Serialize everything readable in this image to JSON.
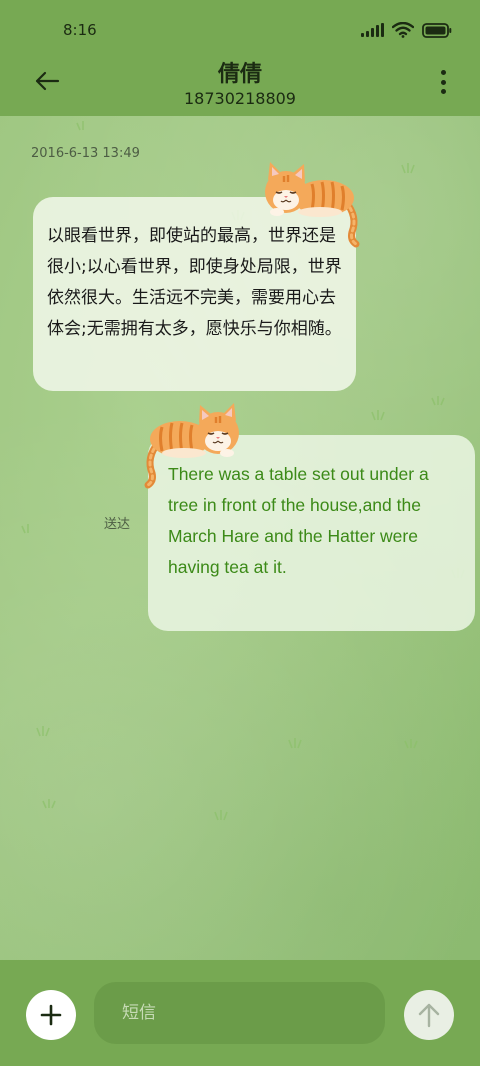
{
  "status_bar": {
    "time": "8:16",
    "icons": [
      "signal-icon",
      "wifi-icon",
      "battery-icon"
    ]
  },
  "header": {
    "contact_name": "倩倩",
    "phone_number": "18730218809",
    "back_icon": "arrow-left-icon",
    "menu_icon": "more-vertical-icon"
  },
  "conversation": {
    "timestamp": "2016-6-13 13:49",
    "messages": [
      {
        "direction": "incoming",
        "text": "以眼看世界，即使站的最高，世界还是很小;以心看世界，即使身处局限，世界依然很大。生活远不完美，需要用心去体会;无需拥有太多，愿快乐与你相随。"
      },
      {
        "direction": "outgoing",
        "text": "There was a table set out under a tree in front of the house,and the March Hare and the Hatter were having tea at it.",
        "status": "送达"
      }
    ]
  },
  "composer": {
    "placeholder": "短信",
    "add_icon": "plus-icon",
    "send_icon": "arrow-up-icon"
  },
  "colors": {
    "bar": "#77a953",
    "outgoing_text": "#3c8a18",
    "background": "#a2c985"
  }
}
